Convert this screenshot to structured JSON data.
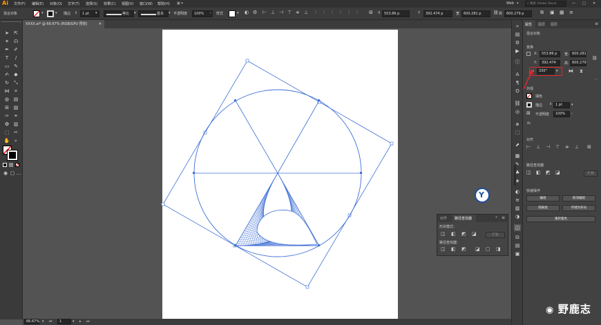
{
  "app": {
    "logo": "Ai"
  },
  "menubar": {
    "items": [
      "文件(F)",
      "编辑(E)",
      "对象(O)",
      "文字(T)",
      "选择(S)",
      "效果(C)",
      "视图(V)",
      "窗口(W)",
      "帮助(H)"
    ],
    "workspace": "Web",
    "search_placeholder": "搜索 Adobe Stock"
  },
  "controlbar": {
    "selection_label": "混合对象",
    "stroke_label": "描边",
    "stroke_value": "1 pt",
    "profile_label": "等比",
    "brush_label": "基本",
    "opacity_label": "不透明度",
    "opacity_value": "100%",
    "style_label": "样式",
    "x_label": "X",
    "x_value": "553.86 p",
    "y_label": "Y",
    "y_value": "392.474 p",
    "w_label": "宽",
    "w_value": "600.281 p",
    "h_label": "高",
    "h_value": "600.279 p"
  },
  "document": {
    "tab_title": "XXXX.ai* @ 66.67% (RGB/GPU 预览)"
  },
  "statusbar": {
    "zoom": "66.67%",
    "page": "1"
  },
  "properties": {
    "tabs": [
      "属性",
      "图层",
      "图层"
    ],
    "object_type": "混合对象",
    "transform_title": "变换",
    "x": "553.86 p",
    "y": "392.474",
    "w": "600.281",
    "h": "600.279",
    "angle": "330°",
    "appearance_title": "外观",
    "fill_label": "填色",
    "stroke_label": "描边",
    "stroke_value": "1 pt",
    "opacity_label": "不透明度",
    "opacity_value": "100%",
    "align_title": "对齐",
    "pathfinder_title": "路径查找器",
    "quick_title": "快速操作",
    "btn_edit": "编组",
    "btn_release": "取消编组",
    "btn_isolate": "隔离组",
    "btn_symbol": "存储为符号",
    "btn_recolor": "重新着色"
  },
  "pathfinder_panel": {
    "tabs": [
      "对齐",
      "路径查找器"
    ],
    "shape_modes_label": "形状模式：",
    "expand_label": "扩展",
    "pathfinders_label": "路径查找器："
  },
  "watermark": {
    "text": "野鹿志"
  },
  "colors": {
    "accent_blue": "#3d6fd6",
    "highlight_red": "#e0272b",
    "orange_logo": "#ff9a00"
  }
}
